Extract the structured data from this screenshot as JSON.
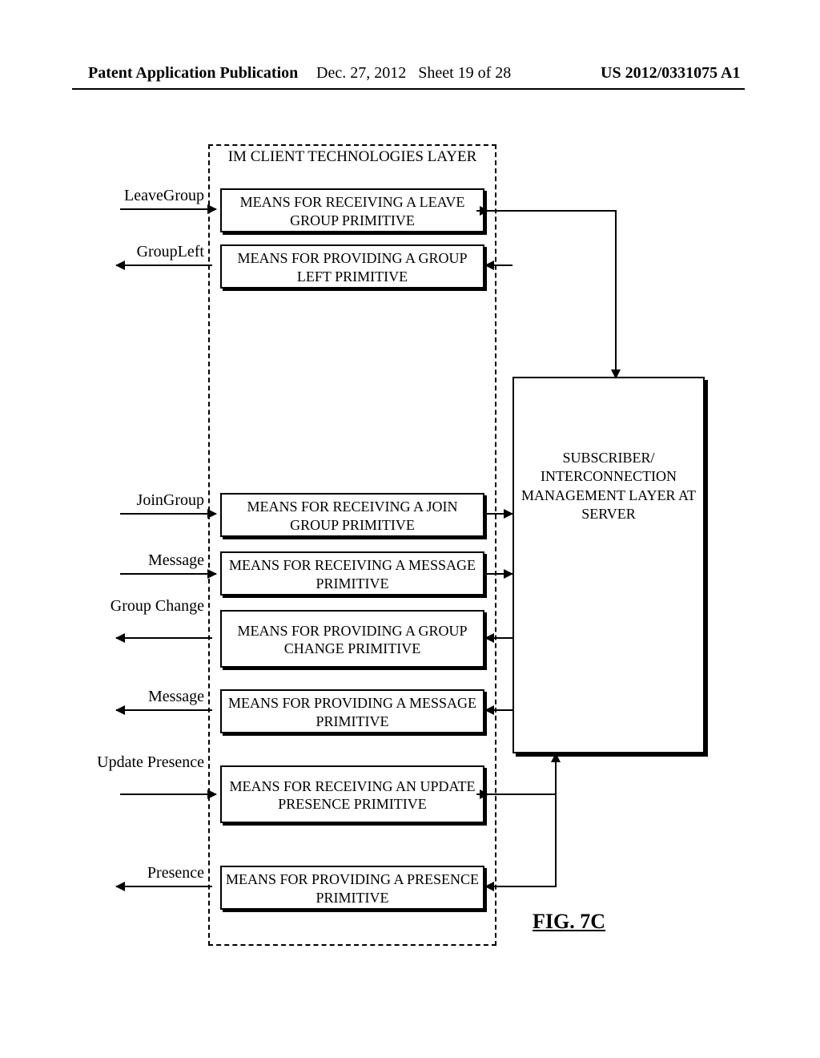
{
  "header": {
    "left": "Patent Application Publication",
    "date": "Dec. 27, 2012",
    "sheet": "Sheet 19 of 28",
    "pubno": "US 2012/0331075 A1"
  },
  "layer_title": "IM CLIENT TECHNOLOGIES LAYER",
  "subscriber_box": "SUBSCRIBER/ INTERCONNECTION MANAGEMENT LAYER AT SERVER",
  "figure_label": "FIG. 7C",
  "primitives": [
    {
      "label": "LeaveGroup",
      "box": "MEANS FOR RECEIVING A LEAVE GROUP PRIMITIVE",
      "dir": "in"
    },
    {
      "label": "GroupLeft",
      "box": "MEANS FOR PROVIDING A GROUP LEFT PRIMITIVE",
      "dir": "out"
    },
    {
      "label": "JoinGroup",
      "box": "MEANS FOR RECEIVING A JOIN GROUP PRIMITIVE",
      "dir": "in"
    },
    {
      "label": "Message",
      "box": "MEANS FOR RECEIVING A MESSAGE PRIMITIVE",
      "dir": "in"
    },
    {
      "label": "Group Change",
      "box": "MEANS FOR PROVIDING A GROUP CHANGE PRIMITIVE",
      "dir": "out"
    },
    {
      "label": "Message",
      "box": "MEANS FOR PROVIDING A MESSAGE PRIMITIVE",
      "dir": "out"
    },
    {
      "label": "Update Presence",
      "box": "MEANS FOR RECEIVING AN UPDATE PRESENCE PRIMITIVE",
      "dir": "in"
    },
    {
      "label": "Presence",
      "box": "MEANS FOR PROVIDING A PRESENCE PRIMITIVE",
      "dir": "out"
    }
  ]
}
